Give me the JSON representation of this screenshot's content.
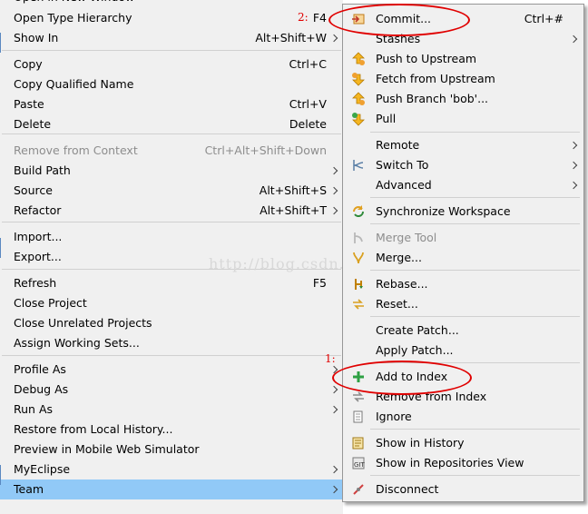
{
  "main_menu": {
    "items": [
      {
        "label": "Open in New Window",
        "accel": "",
        "submenu": false,
        "disabled": false
      },
      {
        "label": "Open Type Hierarchy",
        "accel": "F4",
        "submenu": false,
        "disabled": false
      },
      {
        "label": "Show In",
        "accel": "Alt+Shift+W",
        "submenu": true,
        "disabled": false
      },
      {
        "label": "Copy",
        "accel": "Ctrl+C",
        "submenu": false,
        "disabled": false
      },
      {
        "label": "Copy Qualified Name",
        "accel": "",
        "submenu": false,
        "disabled": false
      },
      {
        "label": "Paste",
        "accel": "Ctrl+V",
        "submenu": false,
        "disabled": false
      },
      {
        "label": "Delete",
        "accel": "Delete",
        "submenu": false,
        "disabled": false
      },
      {
        "label": "Remove from Context",
        "accel": "Ctrl+Alt+Shift+Down",
        "submenu": false,
        "disabled": true
      },
      {
        "label": "Build Path",
        "accel": "",
        "submenu": true,
        "disabled": false
      },
      {
        "label": "Source",
        "accel": "Alt+Shift+S",
        "submenu": true,
        "disabled": false
      },
      {
        "label": "Refactor",
        "accel": "Alt+Shift+T",
        "submenu": true,
        "disabled": false
      },
      {
        "label": "Import...",
        "accel": "",
        "submenu": false,
        "disabled": false
      },
      {
        "label": "Export...",
        "accel": "",
        "submenu": false,
        "disabled": false
      },
      {
        "label": "Refresh",
        "accel": "F5",
        "submenu": false,
        "disabled": false
      },
      {
        "label": "Close Project",
        "accel": "",
        "submenu": false,
        "disabled": false
      },
      {
        "label": "Close Unrelated Projects",
        "accel": "",
        "submenu": false,
        "disabled": false
      },
      {
        "label": "Assign Working Sets...",
        "accel": "",
        "submenu": false,
        "disabled": false
      },
      {
        "label": "Profile As",
        "accel": "",
        "submenu": true,
        "disabled": false
      },
      {
        "label": "Debug As",
        "accel": "",
        "submenu": true,
        "disabled": false
      },
      {
        "label": "Run As",
        "accel": "",
        "submenu": true,
        "disabled": false
      },
      {
        "label": "Restore from Local History...",
        "accel": "",
        "submenu": false,
        "disabled": false
      },
      {
        "label": "Preview in Mobile Web Simulator",
        "accel": "",
        "submenu": false,
        "disabled": false
      },
      {
        "label": "MyEclipse",
        "accel": "",
        "submenu": true,
        "disabled": false
      },
      {
        "label": "Team",
        "accel": "",
        "submenu": true,
        "disabled": false,
        "highlighted": true
      }
    ]
  },
  "team_menu": {
    "items": [
      {
        "label": "Commit...",
        "accel": "Ctrl+#",
        "submenu": false,
        "disabled": false,
        "icon": "commit-icon"
      },
      {
        "label": "Stashes",
        "accel": "",
        "submenu": true,
        "disabled": false,
        "icon": ""
      },
      {
        "label": "Push to Upstream",
        "accel": "",
        "submenu": false,
        "disabled": false,
        "icon": "push-icon"
      },
      {
        "label": "Fetch from Upstream",
        "accel": "",
        "submenu": false,
        "disabled": false,
        "icon": "fetch-icon"
      },
      {
        "label": "Push Branch 'bob'...",
        "accel": "",
        "submenu": false,
        "disabled": false,
        "icon": "push-branch-icon"
      },
      {
        "label": "Pull",
        "accel": "",
        "submenu": false,
        "disabled": false,
        "icon": "pull-icon"
      },
      {
        "label": "Remote",
        "accel": "",
        "submenu": true,
        "disabled": false,
        "icon": ""
      },
      {
        "label": "Switch To",
        "accel": "",
        "submenu": true,
        "disabled": false,
        "icon": "switch-to-icon"
      },
      {
        "label": "Advanced",
        "accel": "",
        "submenu": true,
        "disabled": false,
        "icon": ""
      },
      {
        "label": "Synchronize Workspace",
        "accel": "",
        "submenu": false,
        "disabled": false,
        "icon": "synchronize-icon"
      },
      {
        "label": "Merge Tool",
        "accel": "",
        "submenu": false,
        "disabled": true,
        "icon": "merge-tool-icon"
      },
      {
        "label": "Merge...",
        "accel": "",
        "submenu": false,
        "disabled": false,
        "icon": "merge-icon"
      },
      {
        "label": "Rebase...",
        "accel": "",
        "submenu": false,
        "disabled": false,
        "icon": "rebase-icon"
      },
      {
        "label": "Reset...",
        "accel": "",
        "submenu": false,
        "disabled": false,
        "icon": "reset-icon"
      },
      {
        "label": "Create Patch...",
        "accel": "",
        "submenu": false,
        "disabled": false,
        "icon": ""
      },
      {
        "label": "Apply Patch...",
        "accel": "",
        "submenu": false,
        "disabled": false,
        "icon": ""
      },
      {
        "label": "Add to Index",
        "accel": "",
        "submenu": false,
        "disabled": false,
        "icon": "add-icon"
      },
      {
        "label": "Remove from Index",
        "accel": "",
        "submenu": false,
        "disabled": false,
        "icon": "remove-icon"
      },
      {
        "label": "Ignore",
        "accel": "",
        "submenu": false,
        "disabled": false,
        "icon": "ignore-icon"
      },
      {
        "label": "Show in History",
        "accel": "",
        "submenu": false,
        "disabled": false,
        "icon": "history-icon"
      },
      {
        "label": "Show in Repositories View",
        "accel": "",
        "submenu": false,
        "disabled": false,
        "icon": "repositories-icon"
      },
      {
        "label": "Disconnect",
        "accel": "",
        "submenu": false,
        "disabled": false,
        "icon": "disconnect-icon"
      }
    ]
  },
  "annotations": {
    "step_1": "1:",
    "step_2": "2:"
  },
  "watermark": "http://blog.csdn.net/",
  "colors": {
    "menu_bg": "#f0f0f0",
    "highlight": "#91c9f7",
    "annotation_red": "#e00000",
    "disabled_text": "#8d8d8d"
  }
}
